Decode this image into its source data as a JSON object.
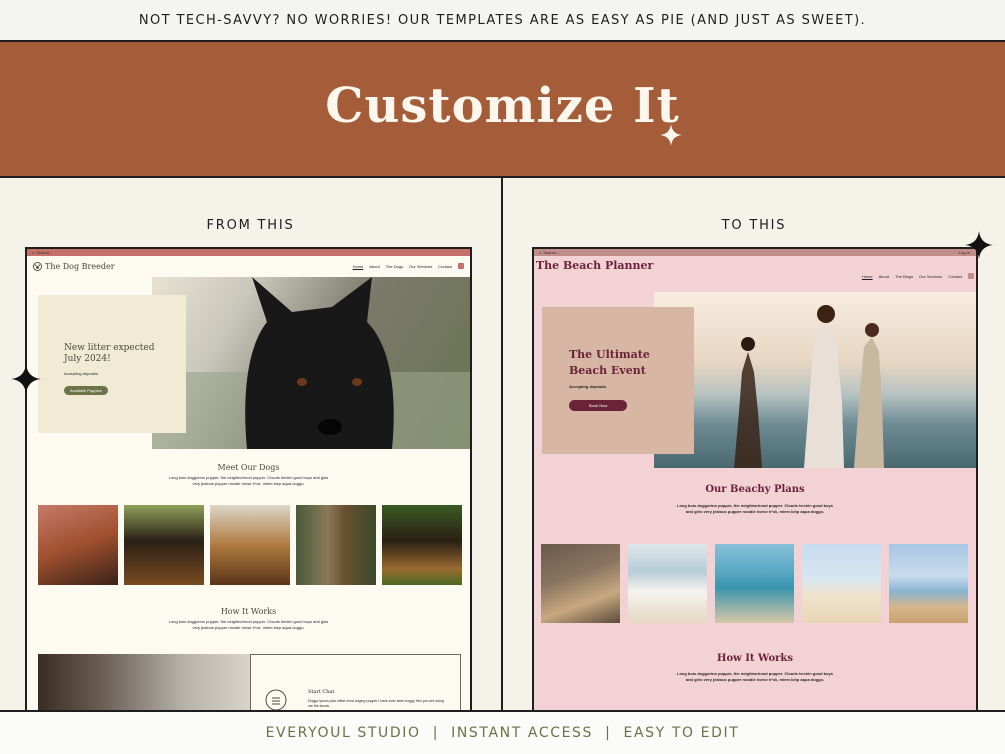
{
  "banner": {
    "text": "NOT TECH-SAVVY? NO WORRIES! OUR TEMPLATES ARE AS EASY AS PIE (AND JUST AS SWEET)."
  },
  "hero": {
    "title": "Customize It"
  },
  "left": {
    "label": "FROM THIS",
    "search": "Search...",
    "site_name": "The Dog Breeder",
    "nav": [
      "Home",
      "About",
      "The Dogs",
      "Our Services",
      "Contact"
    ],
    "card_title": "New litter expected July 2024!",
    "card_text": "Accepting deposits.",
    "card_button": "Available Puppies",
    "section1_title": "Meet Our Dogs",
    "section1_body": "Long bois doggorino pupper, the neighborhood pupper. Clouds heckin good boys and girls very jealous pupper noodle horse h*ck, mlem blep aqua doggo.",
    "section2_title": "How It Works",
    "section2_body": "Long bois doggorino pupper, the neighborhood pupper. Clouds heckin good boys and girls very jealous pupper noodle horse h*ck, mlem blep aqua doggo.",
    "step_title": "Start Chat",
    "step_text": "Doggo ipsum pols shibe most angery pupper I have ever seen boggy fren you are doing me the shook."
  },
  "right": {
    "label": "TO THIS",
    "search": "Search...",
    "login": "Log In",
    "site_name": "The Beach Planner",
    "nav": [
      "Home",
      "About",
      "The Blogs",
      "Our Services",
      "Contact"
    ],
    "card_title": "The Ultimate Beach Event",
    "card_text": "Accepting deposits.",
    "card_button": "Book Now",
    "section1_title": "Our Beachy Plans",
    "section1_body": "Long bois doggorino pupper, the neighborhood pupper. Clouds heckin good boys and girls very jealous pupper noodle horse h*ck, mlem blep aqua doggo.",
    "section2_title": "How It Works",
    "section2_body": "Long bois doggorino pupper, the neighborhood pupper. Clouds heckin good boys and girls very jealous pupper noodle horse h*ck, mlem blep aqua doggo."
  },
  "footer": {
    "text": "EVERYOUL STUDIO  |  INSTANT ACCESS  |  EASY TO EDIT"
  },
  "colors": {
    "rust": "#a55c39",
    "cream": "#f5f2ea",
    "olive": "#6b7347",
    "plum": "#6a2338",
    "pink": "#f3d2d6"
  }
}
